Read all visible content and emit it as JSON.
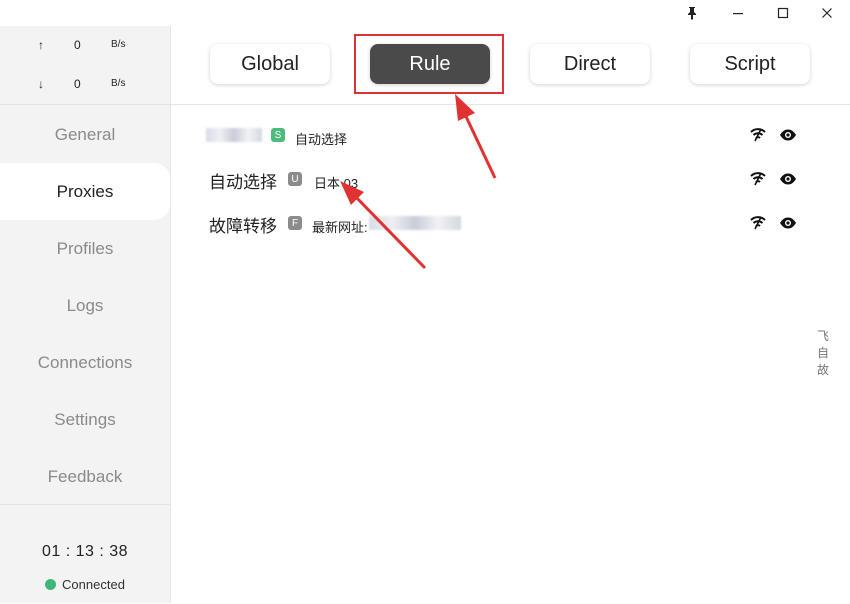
{
  "window": {
    "controls": [
      "pin-icon",
      "minimize-icon",
      "maximize-icon",
      "close-icon"
    ]
  },
  "traffic": {
    "up_arrow": "↑",
    "up_value": "0",
    "up_unit": "B/s",
    "down_arrow": "↓",
    "down_value": "0",
    "down_unit": "B/s"
  },
  "nav": {
    "items": [
      {
        "label": "General"
      },
      {
        "label": "Proxies"
      },
      {
        "label": "Profiles"
      },
      {
        "label": "Logs"
      },
      {
        "label": "Connections"
      },
      {
        "label": "Settings"
      },
      {
        "label": "Feedback"
      }
    ],
    "active": "Proxies"
  },
  "footer": {
    "timer": "01 : 13 : 38",
    "status": "Connected",
    "status_color": "#3fb77b"
  },
  "modes": {
    "items": [
      {
        "label": "Global"
      },
      {
        "label": "Rule"
      },
      {
        "label": "Direct"
      },
      {
        "label": "Script"
      }
    ],
    "active": "Rule"
  },
  "proxies": [
    {
      "badge": "S",
      "value": "自动选择"
    },
    {
      "name": "自动选择",
      "badge": "U",
      "value": "日本 03"
    },
    {
      "name": "故障转移",
      "badge": "F",
      "value": "最新网址:"
    }
  ],
  "side_text": [
    "飞",
    "自",
    "故"
  ],
  "colors": {
    "active_mode_bg": "#4a4a4a",
    "annotation_red": "#e03232",
    "badge_select": "#4dbb7d",
    "badge_other": "#8b8b8b"
  }
}
